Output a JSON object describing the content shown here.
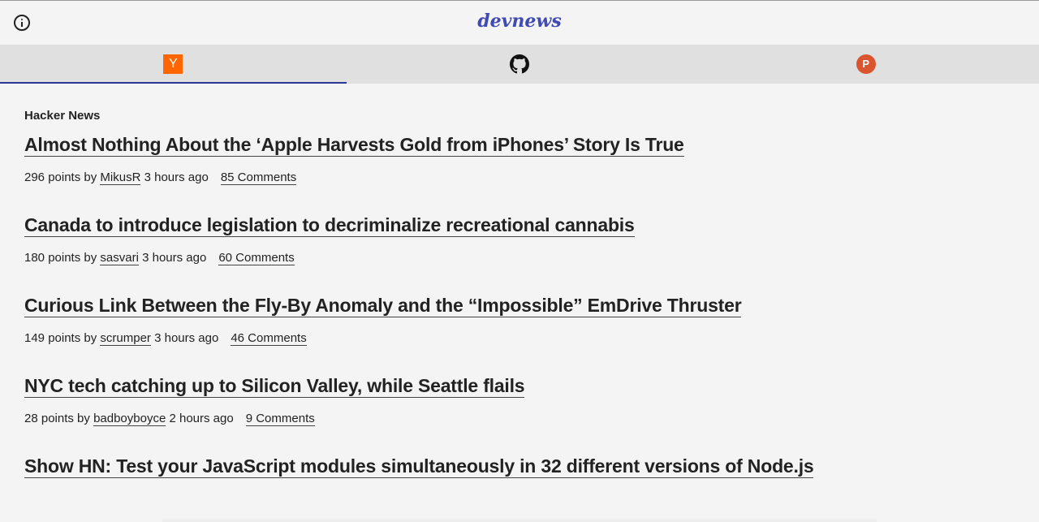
{
  "header": {
    "brand": "devnews",
    "info_icon": "info-circle-icon"
  },
  "tabs": [
    {
      "name": "hacker-news",
      "icon": "y-combinator-icon",
      "icon_text": "Y",
      "active": true
    },
    {
      "name": "github",
      "icon": "github-icon",
      "active": false
    },
    {
      "name": "product-hunt",
      "icon": "product-hunt-icon",
      "icon_text": "P",
      "active": false
    }
  ],
  "colors": {
    "brand": "#3f4ab3",
    "active_tab_indicator": "#2d3794",
    "hn_orange": "#ff6600",
    "ph_red": "#da552f",
    "background": "#f4f4f4",
    "tabbar": "#e0e0e0"
  },
  "section": {
    "title": "Hacker News"
  },
  "stories": [
    {
      "title": "Almost Nothing About the ‘Apple Harvests Gold from iPhones’ Story Is True",
      "points_prefix": "296 points by ",
      "user": "MikusR",
      "time": " 3 hours ago",
      "comments": "85 Comments"
    },
    {
      "title": "Canada to introduce legislation to decriminalize recreational cannabis",
      "points_prefix": "180 points by ",
      "user": "sasvari",
      "time": " 3 hours ago",
      "comments": "60 Comments"
    },
    {
      "title": "Curious Link Between the Fly-By Anomaly and the “Impossible” EmDrive Thruster",
      "points_prefix": "149 points by ",
      "user": "scrumper",
      "time": " 3 hours ago",
      "comments": "46 Comments"
    },
    {
      "title": "NYC tech catching up to Silicon Valley, while Seattle flails",
      "points_prefix": "28 points by ",
      "user": "badboyboyce",
      "time": " 2 hours ago",
      "comments": "9 Comments"
    },
    {
      "title": "Show HN: Test your JavaScript modules simultaneously in 32 different versions of Node.js"
    }
  ]
}
